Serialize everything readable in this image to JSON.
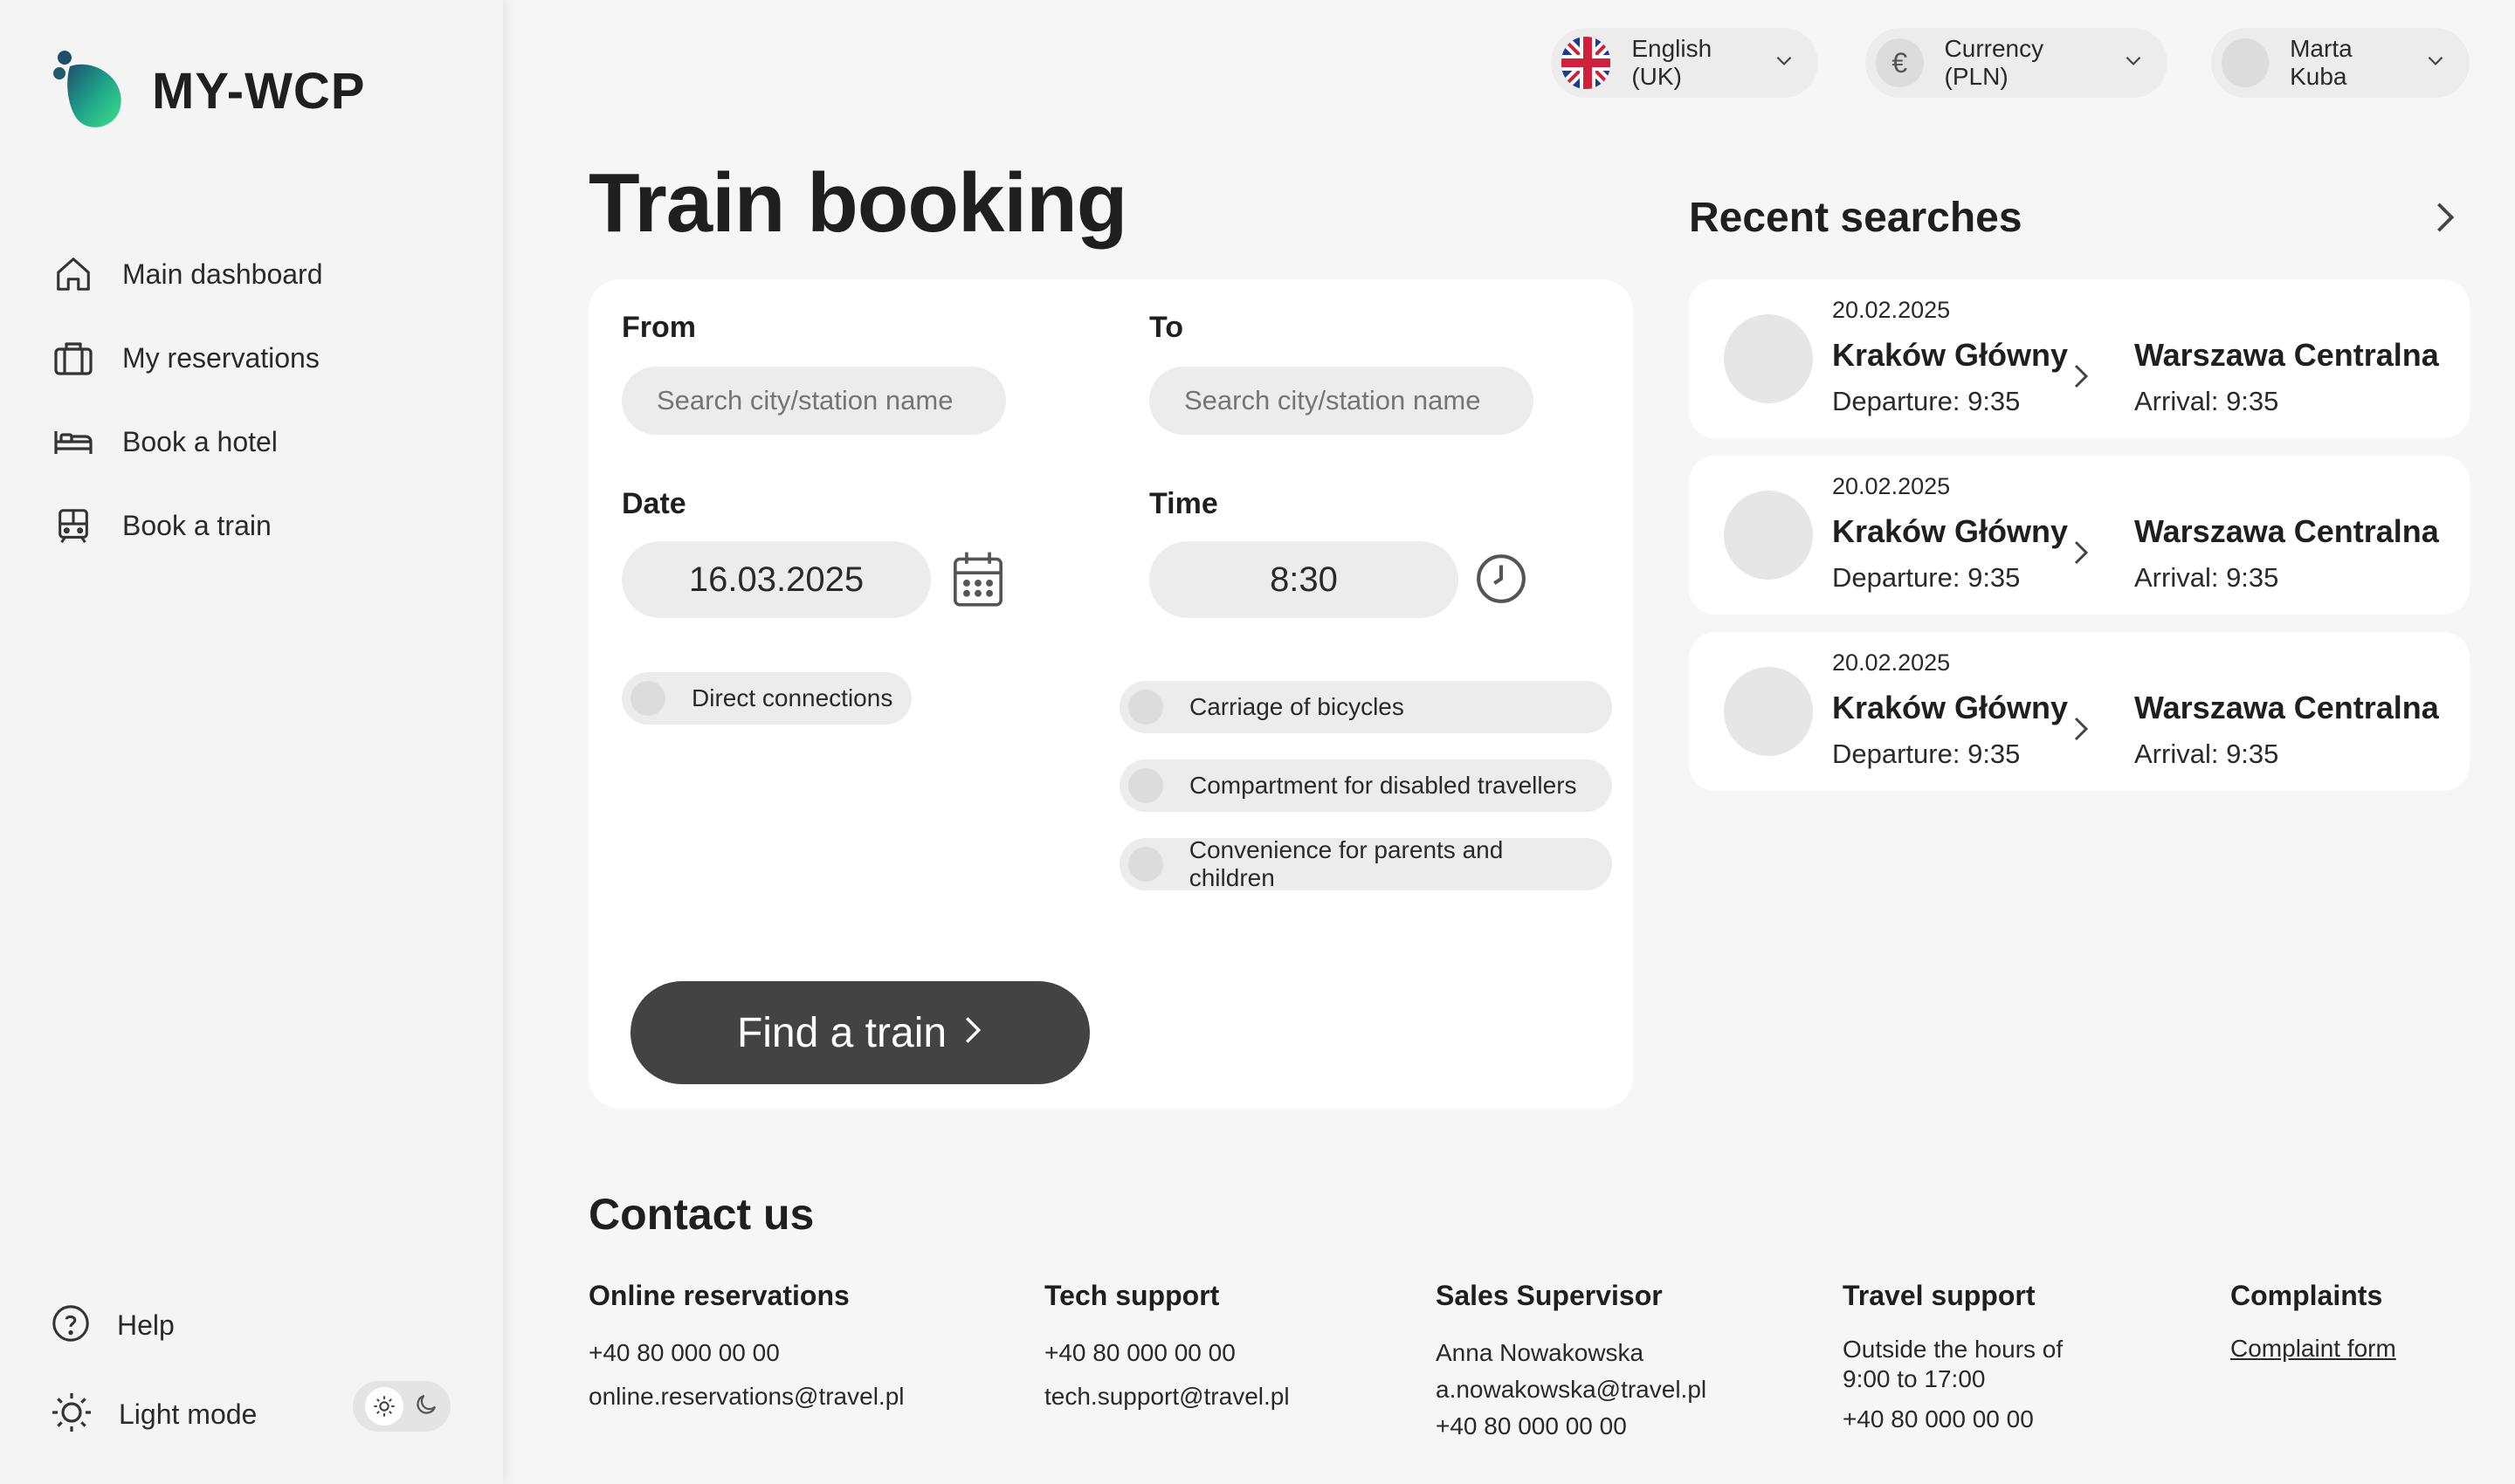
{
  "app": {
    "logo_text": "MY-WCP"
  },
  "sidebar": {
    "items": [
      {
        "label": "Main dashboard",
        "icon": "home-icon"
      },
      {
        "label": "My reservations",
        "icon": "briefcase-icon"
      },
      {
        "label": "Book a hotel",
        "icon": "bed-icon"
      },
      {
        "label": "Book a train",
        "icon": "train-icon"
      }
    ],
    "help_label": "Help",
    "mode_label": "Light mode"
  },
  "topbar": {
    "language": "English (UK)",
    "currency": "Currency (PLN)",
    "currency_symbol": "€",
    "user": "Marta Kuba"
  },
  "page": {
    "title": "Train booking"
  },
  "form": {
    "from_label": "From",
    "to_label": "To",
    "from_placeholder": "Search city/station name",
    "to_placeholder": "Search city/station name",
    "date_label": "Date",
    "date_value": "16.03.2025",
    "time_label": "Time",
    "time_value": "8:30",
    "options": {
      "direct": "Direct connections",
      "bicycles": "Carriage of bicycles",
      "disabled": "Compartment for disabled travellers",
      "parents": "Convenience for parents and children"
    },
    "submit_label": "Find a train"
  },
  "recent": {
    "title": "Recent searches",
    "items": [
      {
        "date": "20.02.2025",
        "from": "Kraków Główny",
        "departure": "Departure: 9:35",
        "to": "Warszawa Centralna",
        "arrival": "Arrival: 9:35"
      },
      {
        "date": "20.02.2025",
        "from": "Kraków Główny",
        "departure": "Departure: 9:35",
        "to": "Warszawa Centralna",
        "arrival": "Arrival: 9:35"
      },
      {
        "date": "20.02.2025",
        "from": "Kraków Główny",
        "departure": "Departure: 9:35",
        "to": "Warszawa Centralna",
        "arrival": "Arrival: 9:35"
      }
    ]
  },
  "contact": {
    "title": "Contact us",
    "online": {
      "heading": "Online reservations",
      "phone": "+40 80 000 00 00",
      "email": "online.reservations@travel.pl"
    },
    "tech": {
      "heading": "Tech support",
      "phone": "+40 80 000 00 00",
      "email": "tech.support@travel.pl"
    },
    "sales": {
      "heading": "Sales Supervisor",
      "name": "Anna Nowakowska",
      "email": "a.nowakowska@travel.pl",
      "phone": "+40 80 000 00 00"
    },
    "travel": {
      "heading": "Travel support",
      "hours_line1": "Outside the hours of",
      "hours_line2": "9:00 to 17:00",
      "phone": "+40 80 000 00 00"
    },
    "complaints": {
      "heading": "Complaints",
      "link": "Complaint form"
    }
  },
  "colors": {
    "accent_start": "#1a6b6b",
    "accent_end": "#3fd58a",
    "button": "#434343"
  }
}
